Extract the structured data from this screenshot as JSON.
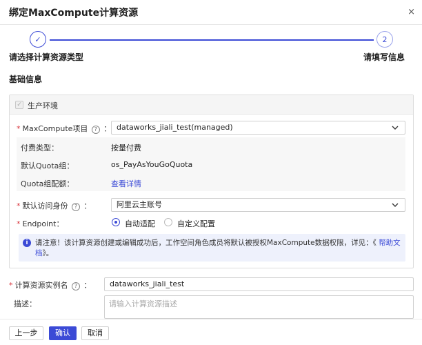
{
  "dialog": {
    "title": "绑定MaxCompute计算资源",
    "close": "×"
  },
  "steps": [
    {
      "number": "✓",
      "label": "请选择计算资源类型"
    },
    {
      "number": "2",
      "label": "请填写信息"
    }
  ],
  "section_title": "基础信息",
  "panel": {
    "checkbox_label": "生产环境",
    "project_label": "MaxCompute项目",
    "project_value": "dataworks_jiali_test(managed)",
    "pay_type_label": "付费类型：",
    "pay_type_value": "按量付费",
    "quota_group_label": "默认Quota组：",
    "quota_group_value": "os_PayAsYouGoQuota",
    "quota_config_label": "Quota组配额：",
    "quota_config_link": "查看详情",
    "identity_label": "默认访问身份",
    "identity_value": "阿里云主账号",
    "endpoint_label": "Endpoint：",
    "endpoint_options": [
      "自动适配",
      "自定义配置"
    ],
    "notice_text": "请注意！该计算资源创建或编辑成功后，工作空间角色成员将默认被授权MaxCompute数据权限，详见：《",
    "notice_link": "帮助文档",
    "notice_tail": "》。"
  },
  "instance": {
    "name_label": "计算资源实例名",
    "name_value": "dataworks_jiali_test",
    "desc_label": "描述：",
    "desc_placeholder": "请输入计算资源描述"
  },
  "footer": {
    "prev": "上一步",
    "confirm": "确认",
    "cancel": "取消"
  }
}
